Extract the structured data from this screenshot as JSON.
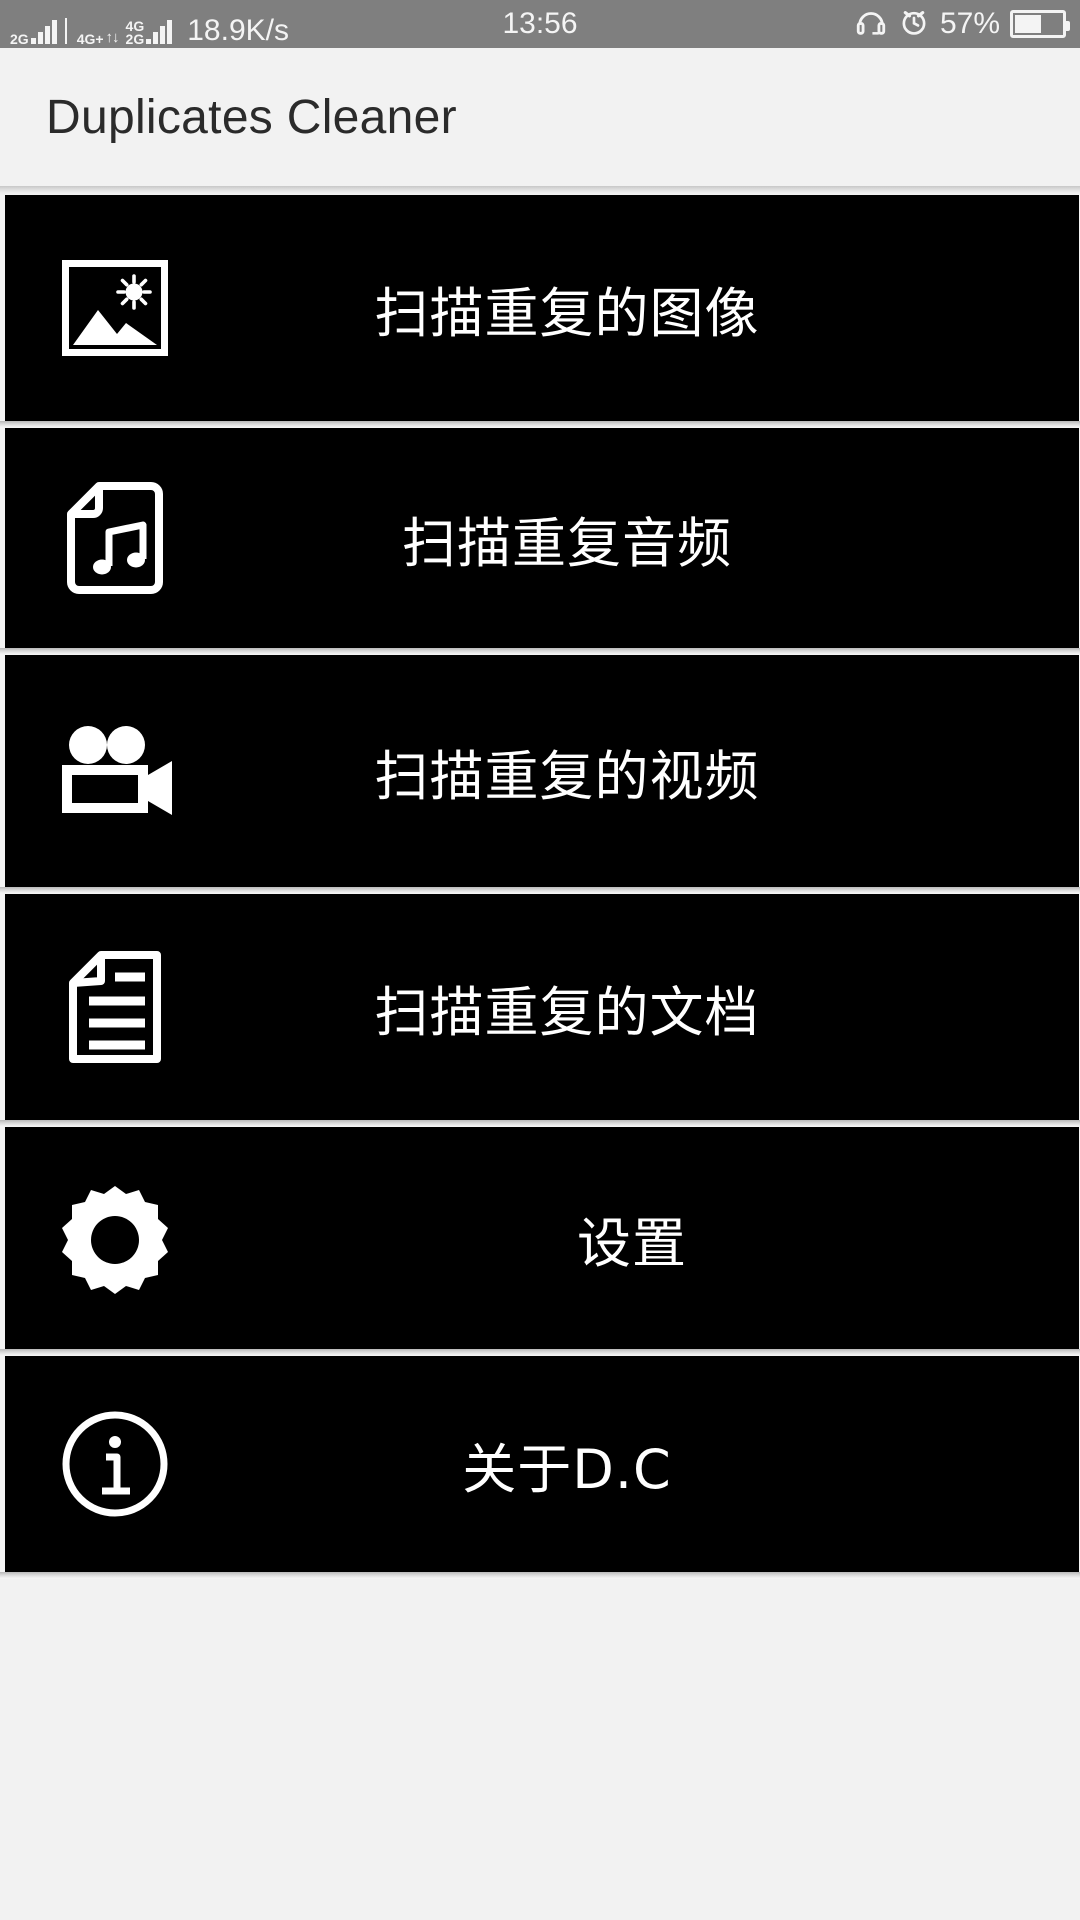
{
  "status_bar": {
    "background_color": "#7f7f7f",
    "sim1_label": "2G",
    "sim2_label": "4G+",
    "sim2_sup": "+",
    "sim3_top": "4G",
    "sim3_bottom": "2G",
    "data_arrows": "↑↓",
    "network_speed": "18.9K/s",
    "time": "13:56",
    "battery_percent": "57%",
    "battery_level": 57,
    "headset_icon": "headset-icon",
    "alarm_icon": "alarm-clock-icon",
    "battery_icon": "battery-icon",
    "signal_icon": "signal-bars-icon"
  },
  "header": {
    "title": "Duplicates Cleaner",
    "background_color": "#f2f2f2",
    "text_color": "#2b2b2b"
  },
  "menu": {
    "card_background": "#000000",
    "label_color": "#ffffff",
    "items": [
      {
        "id": "scan-duplicate-images",
        "label": "扫描重复的图像",
        "icon": "photo-landscape-icon"
      },
      {
        "id": "scan-duplicate-audio",
        "label": "扫描重复音频",
        "icon": "music-file-icon"
      },
      {
        "id": "scan-duplicate-video",
        "label": "扫描重复的视频",
        "icon": "movie-camera-icon"
      },
      {
        "id": "scan-duplicate-docs",
        "label": "扫描重复的文档",
        "icon": "document-icon"
      },
      {
        "id": "settings",
        "label": "设置",
        "icon": "gear-icon"
      },
      {
        "id": "about",
        "label": "关于D.C",
        "icon": "info-circle-icon"
      }
    ]
  }
}
